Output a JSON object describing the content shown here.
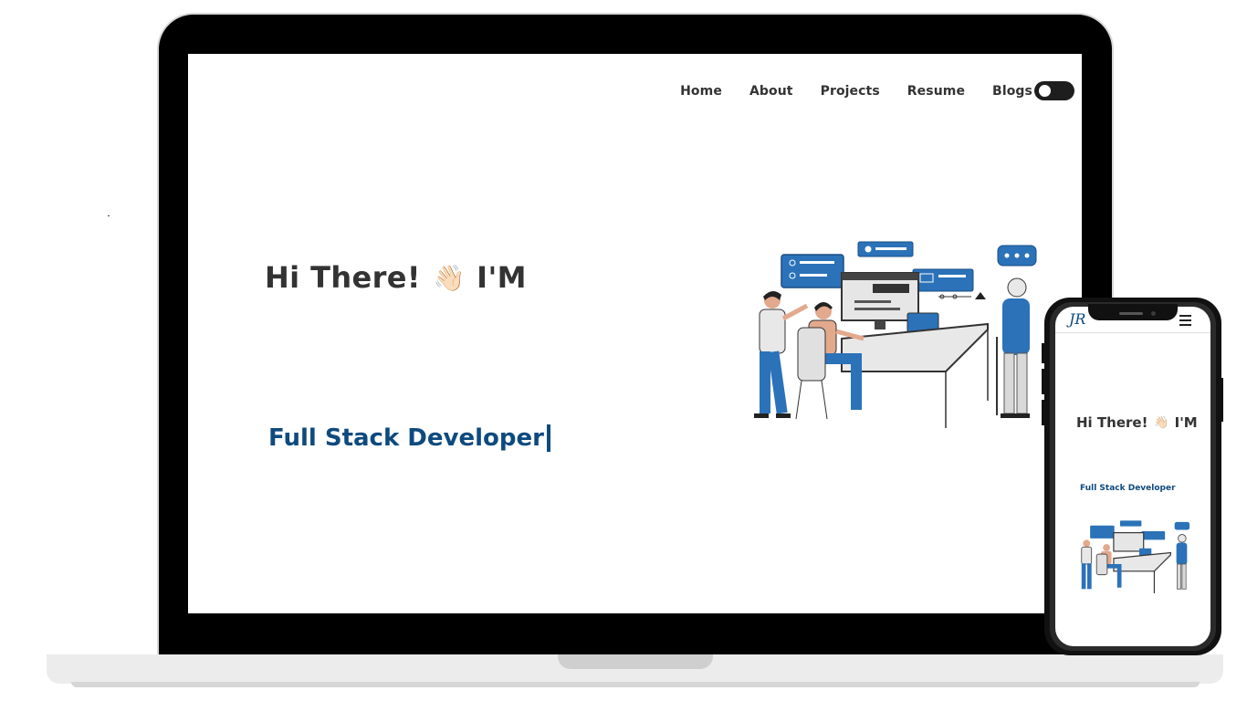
{
  "nav": {
    "items": [
      "Home",
      "About",
      "Projects",
      "Resume",
      "Blogs"
    ],
    "theme_toggle": "off"
  },
  "hero": {
    "greeting_before": "Hi There!",
    "wave_emoji": "👋🏻",
    "greeting_after": "I'M",
    "typed_text": "Full Stack Developer"
  },
  "mobile": {
    "logo": "JR",
    "greeting_before": "Hi There!",
    "wave_emoji": "👋🏻",
    "greeting_after": "I'M",
    "typed_text": "Full Stack Developer"
  },
  "colors": {
    "accent": "#0e4a7e",
    "illustration_blue": "#2b72b9",
    "text": "#333333"
  }
}
